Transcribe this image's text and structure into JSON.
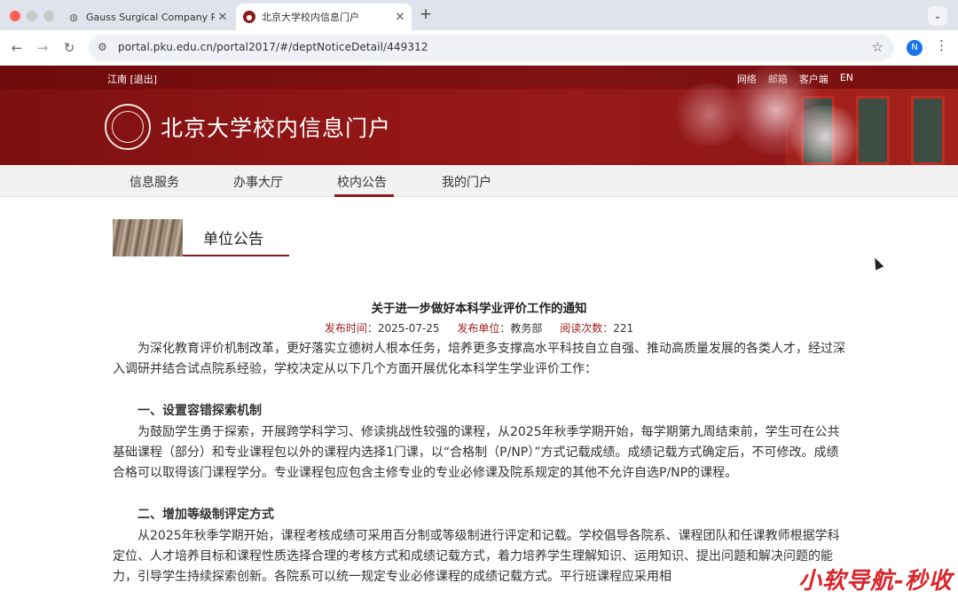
{
  "browser": {
    "tabs": [
      {
        "title": "Gauss Surgical Company Pro",
        "close": "✕"
      },
      {
        "title": "北京大学校内信息门户",
        "close": "✕"
      }
    ],
    "new_tab": "+",
    "tab_menu": "⌄",
    "url": "portal.pku.edu.cn/portal2017/#/deptNoticeDetail/449312",
    "profile_initial": "N",
    "icons": {
      "back": "←",
      "forward": "→",
      "reload": "↻",
      "site_info": "⚙",
      "star": "☆",
      "kebab": "⋮"
    }
  },
  "header": {
    "user": "江南 [退出]",
    "top_links": [
      "网络",
      "邮箱",
      "客户端",
      "EN"
    ],
    "site_title": "北京大学校内信息门户"
  },
  "nav": {
    "items": [
      "信息服务",
      "办事大厅",
      "校内公告",
      "我的门户"
    ],
    "active_index": 2
  },
  "section": {
    "label": "单位公告"
  },
  "notice": {
    "title": "关于进一步做好本科学业评价工作的通知",
    "meta": {
      "publish_time_label": "发布时间：",
      "publish_time": "2025-07-25",
      "unit_label": "发布单位：",
      "unit": "教务部",
      "reads_label": "阅读次数：",
      "reads": "221"
    },
    "intro": "为深化教育评价机制改革，更好落实立德树人根本任务，培养更多支撑高水平科技自立自强、推动高质量发展的各类人才，经过深入调研并结合试点院系经验，学校决定从以下几个方面开展优化本科学生学业评价工作：",
    "sections": [
      {
        "heading": "一、设置容错探索机制",
        "body": "为鼓励学生勇于探索，开展跨学科学习、修读挑战性较强的课程，从2025年秋季学期开始，每学期第九周结束前，学生可在公共基础课程（部分）和专业课程包以外的课程内选择1门课，以“合格制（P/NP）”方式记载成绩。成绩记载方式确定后，不可修改。成绩合格可以取得该门课程学分。专业课程包应包含主修专业的专业必修课及院系规定的其他不允许自选P/NP的课程。"
      },
      {
        "heading": "二、增加等级制评定方式",
        "body": "从2025年秋季学期开始，课程考核成绩可采用百分制或等级制进行评定和记载。学校倡导各院系、课程团队和任课教师根据学科定位、人才培养目标和课程性质选择合理的考核方式和成绩记载方式，着力培养学生理解知识、运用知识、提出问题和解决问题的能力，引导学生持续探索创新。各院系可以统一规定专业必修课程的成绩记载方式。平行班课程应采用相"
      }
    ]
  },
  "watermark": "小软导航-秒收"
}
